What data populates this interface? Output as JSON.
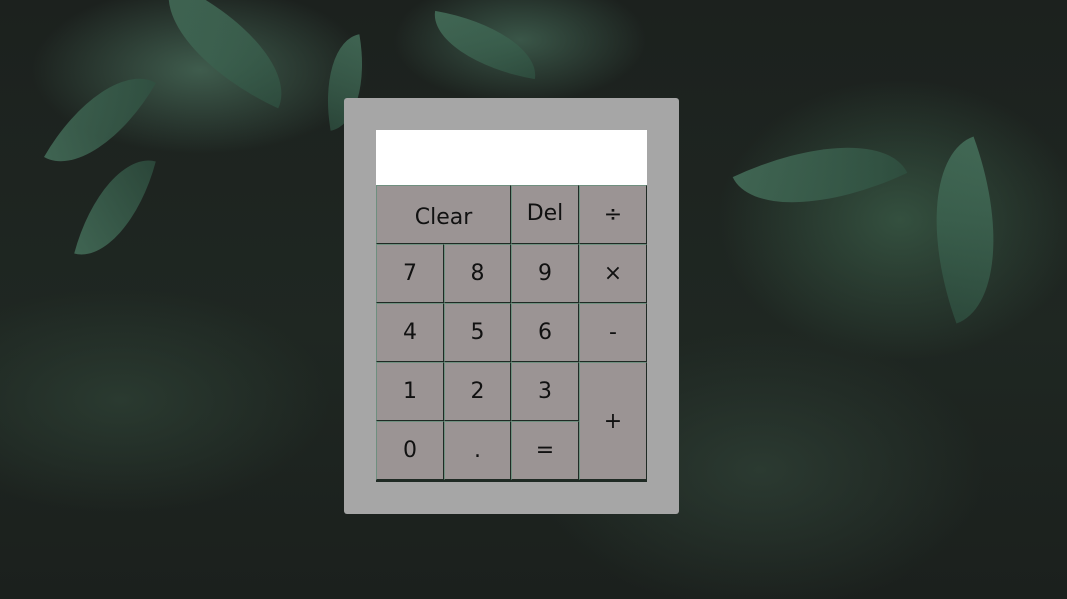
{
  "calculator": {
    "display_value": "",
    "buttons": {
      "clear": "Clear",
      "del": "Del",
      "divide": "÷",
      "seven": "7",
      "eight": "8",
      "nine": "9",
      "multiply": "×",
      "four": "4",
      "five": "5",
      "six": "6",
      "minus": "-",
      "one": "1",
      "two": "2",
      "three": "3",
      "plus": "+",
      "zero": "0",
      "dot": ".",
      "equals": "="
    }
  },
  "colors": {
    "panel": "#a6a6a6",
    "button": "#9b9494",
    "display": "#ffffff"
  }
}
